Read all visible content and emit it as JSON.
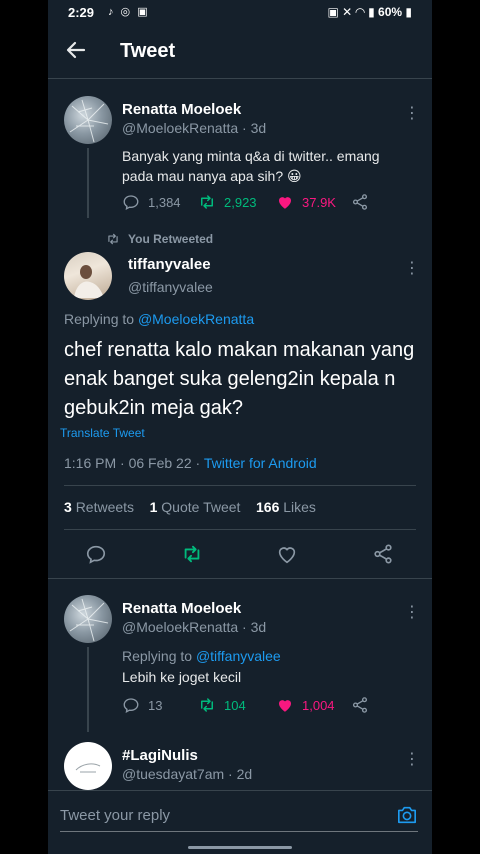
{
  "status_bar": {
    "time": "2:29",
    "battery": "60%"
  },
  "header": {
    "title": "Tweet"
  },
  "tweet1": {
    "name": "Renatta Moeloek",
    "handle": "@MoeloekRenatta",
    "age": "3d",
    "text": "Banyak yang minta q&a di twitter.. emang pada mau nanya apa sih? 😀",
    "replies": "1,384",
    "retweets": "2,923",
    "likes": "37.9K"
  },
  "retweeted_label": "You Retweeted",
  "main_tweet": {
    "name": "tiffanyvalee",
    "handle": "@tiffanyvalee",
    "replying_prefix": "Replying to ",
    "replying_to": "@MoeloekRenatta",
    "text": "chef renatta kalo makan makanan yang enak banget suka geleng2in kepala n gebuk2in meja gak?",
    "translate": "Translate Tweet",
    "datetime": "1:16 PM · 06 Feb 22 · ",
    "source": "Twitter for Android",
    "retweets_count": "3",
    "retweets_label": "Retweets",
    "quote_count": "1",
    "quote_label": "Quote Tweet",
    "likes_count": "166",
    "likes_label": "Likes"
  },
  "reply1": {
    "name": "Renatta Moeloek",
    "handle": "@MoeloekRenatta",
    "age": "3d",
    "replying_prefix": "Replying to ",
    "replying_to": "@tiffanyvalee",
    "text": "Lebih ke joget kecil",
    "replies": "13",
    "retweets": "104",
    "likes": "1,004"
  },
  "reply2": {
    "name": "#LagiNulis",
    "handle": "@tuesdayat7am",
    "age": "2d"
  },
  "reply_input": {
    "placeholder": "Tweet your reply"
  },
  "colors": {
    "background": "#15202b",
    "accent": "#1d9bf0",
    "retweet_green": "#00ba7c",
    "like_pink": "#f91880"
  }
}
